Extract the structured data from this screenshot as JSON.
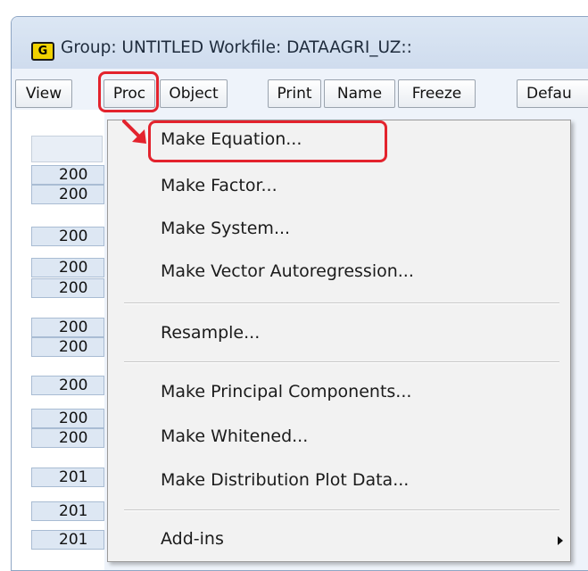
{
  "window": {
    "icon_letter": "G",
    "title": "Group: UNTITLED   Workfile: DATAAGRI_UZ::"
  },
  "toolbar": {
    "view": "View",
    "proc": "Proc",
    "object": "Object",
    "print": "Print",
    "name": "Name",
    "freeze": "Freeze",
    "default": "Defau"
  },
  "sheet": {
    "rows": [
      "200",
      "200",
      "200",
      "200",
      "200",
      "200",
      "200",
      "200",
      "200",
      "200",
      "201",
      "201",
      "201"
    ]
  },
  "menu": {
    "items": [
      "Make Equation...",
      "Make Factor...",
      "Make System...",
      "Make Vector Autoregression...",
      "Resample...",
      "Make Principal Components...",
      "Make Whitened...",
      "Make Distribution Plot Data...",
      "Add-ins"
    ]
  },
  "colors": {
    "highlight_red": "#e3232d",
    "menu_bg": "#f2f2f2"
  }
}
